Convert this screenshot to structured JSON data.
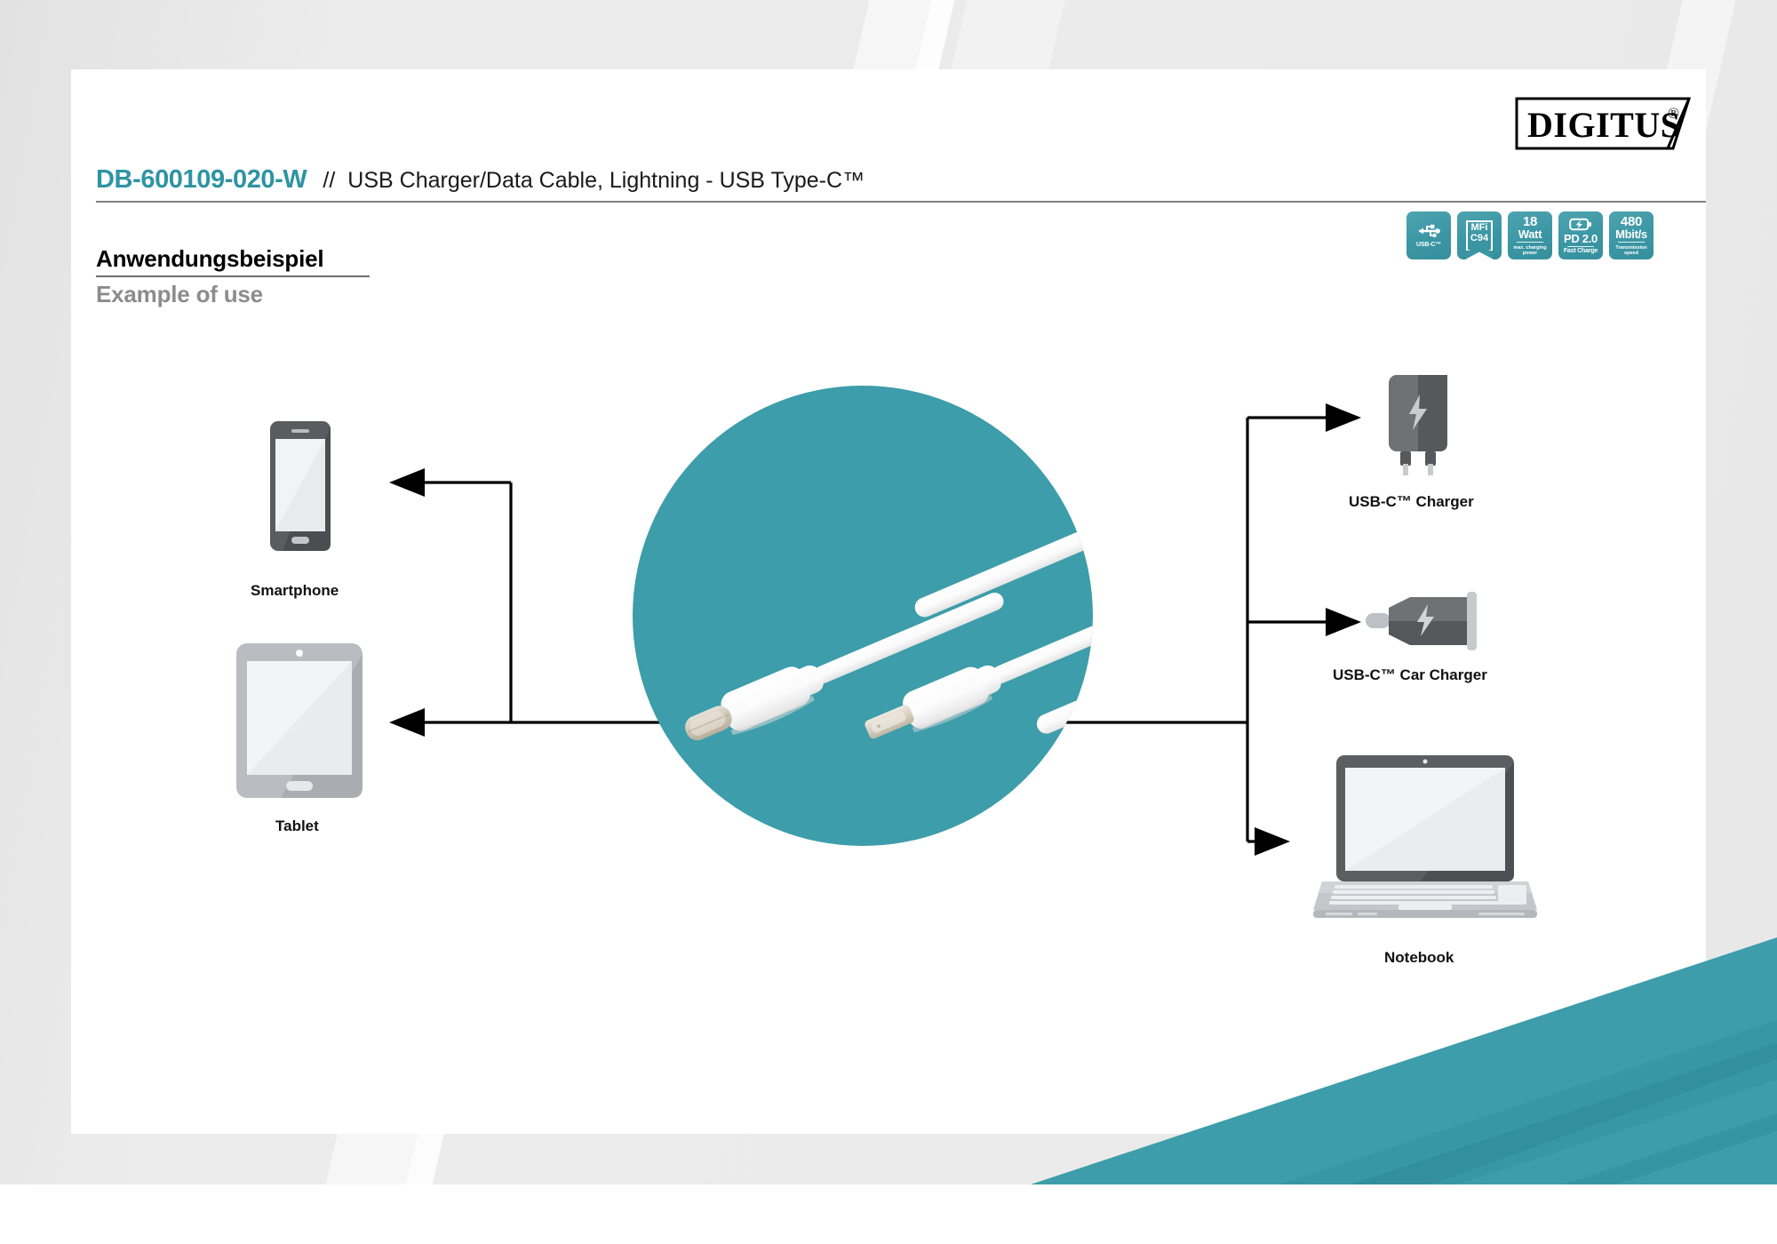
{
  "header": {
    "logo_text": "DIGITUS",
    "logo_registered": "®",
    "sku": "DB-600109-020-W",
    "separator": "//",
    "description": "USB Charger/Data Cable, Lightning - USB Type-C™"
  },
  "section": {
    "heading_de": "Anwendungsbeispiel",
    "heading_en": "Example of use"
  },
  "badges": [
    {
      "name": "usb-c-badge",
      "icon": "usb-trident-icon",
      "label": "USB-C™"
    },
    {
      "name": "mfi-badge",
      "icon": "ribbon-icon",
      "line1": "MFi",
      "line2": "C94"
    },
    {
      "name": "watt-badge",
      "big": "18",
      "mid": "Watt",
      "sub": "max. charging power"
    },
    {
      "name": "pd-badge",
      "icon": "battery-bolt-icon",
      "mid": "PD 2.0",
      "label": "Fast Charge"
    },
    {
      "name": "speed-badge",
      "big": "480",
      "mid": "Mbit/s",
      "sub": "Transmission speed"
    }
  ],
  "devices": {
    "left": [
      {
        "name": "smartphone",
        "label": "Smartphone"
      },
      {
        "name": "tablet",
        "label": "Tablet"
      }
    ],
    "right": [
      {
        "name": "usb-c-charger",
        "label": "USB-C™ Charger"
      },
      {
        "name": "usb-c-car-charger",
        "label": "USB-C™ Car Charger"
      },
      {
        "name": "notebook",
        "label": "Notebook"
      }
    ]
  },
  "product": {
    "connector_left": "USB Type-C connector",
    "connector_right": "Lightning connector",
    "cable_color": "#ffffff"
  },
  "colors": {
    "brand_teal": "#3d9daa",
    "title_teal": "#2e94a3",
    "page_bg": "#eaeaea",
    "card_bg": "#ffffff",
    "muted_gray": "#8c8c8c"
  }
}
